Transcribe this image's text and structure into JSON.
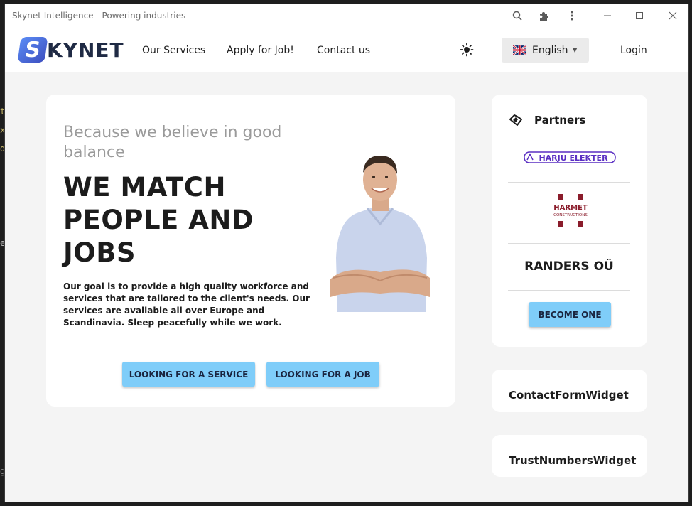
{
  "window": {
    "title": "Skynet Intelligence - Powering industries"
  },
  "background": {
    "letters": [
      "t",
      "x",
      "d",
      "e",
      "g"
    ]
  },
  "titlebar_icons": [
    "zoom-icon",
    "puzzle-icon",
    "more-vert-icon",
    "minimize-icon",
    "maximize-icon",
    "close-icon"
  ],
  "navbar": {
    "logo_letter": "S",
    "logo_text": "KYNET",
    "links": [
      "Our Services",
      "Apply for Job!",
      "Contact us"
    ],
    "language": "English",
    "login": "Login"
  },
  "hero": {
    "subtitle": "Because we believe in good balance",
    "title": "WE MATCH PEOPLE AND JOBS",
    "description": "Our goal is to provide a high quality workforce and services that are tailored to the client's needs. Our services are available all over Europe and Scandinavia. Sleep peacefully while we work.",
    "button_service": "LOOKING FOR A SERVICE",
    "button_job": "LOOKING FOR A JOB"
  },
  "partners": {
    "title": "Partners",
    "harju_logo": "HARJU ELEKTER",
    "harmet_logo": "HARMET",
    "harmet_sub": "CONSTRUCTIONS",
    "randers": "RANDERS OÜ",
    "become_button": "BECOME ONE"
  },
  "widgets": {
    "contact": "ContactFormWidget",
    "trust": "TrustNumbersWidget"
  },
  "colors": {
    "accent_button": "#7fcdf9",
    "logo_blue": "#3d4fc0",
    "harju_purple": "#5a2fc2",
    "harmet_red": "#8a1c2b"
  }
}
